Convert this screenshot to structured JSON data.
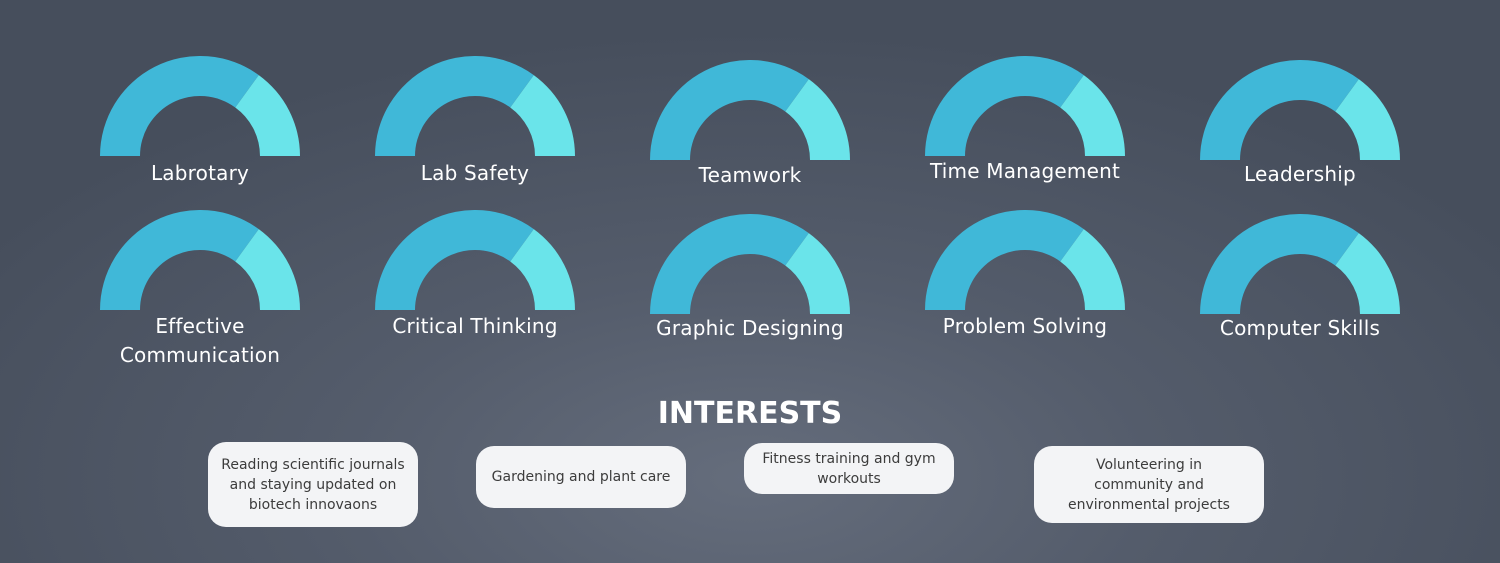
{
  "skills": [
    {
      "label": "Labrotary",
      "level": 0.7
    },
    {
      "label": "Lab Safety",
      "level": 0.7
    },
    {
      "label": "Teamwork",
      "level": 0.7
    },
    {
      "label": "Time Management",
      "level": 0.7
    },
    {
      "label": "Leadership",
      "level": 0.7
    },
    {
      "label": "Effective\nCommunication",
      "level": 0.7
    },
    {
      "label": "Critical Thinking",
      "level": 0.7
    },
    {
      "label": "Graphic Designing",
      "level": 0.7
    },
    {
      "label": "Problem Solving",
      "level": 0.7
    },
    {
      "label": "Computer Skills",
      "level": 0.7
    }
  ],
  "gauge_colors": {
    "filled": "#40b8d8",
    "remaining": "#6ae4ea"
  },
  "interests_heading": "INTERESTS",
  "interests": [
    "Reading scientific journals and staying updated on biotech innovaons",
    "Gardening and plant care",
    "Fitness training and gym workouts",
    "Volunteering in community and environmental projects"
  ]
}
